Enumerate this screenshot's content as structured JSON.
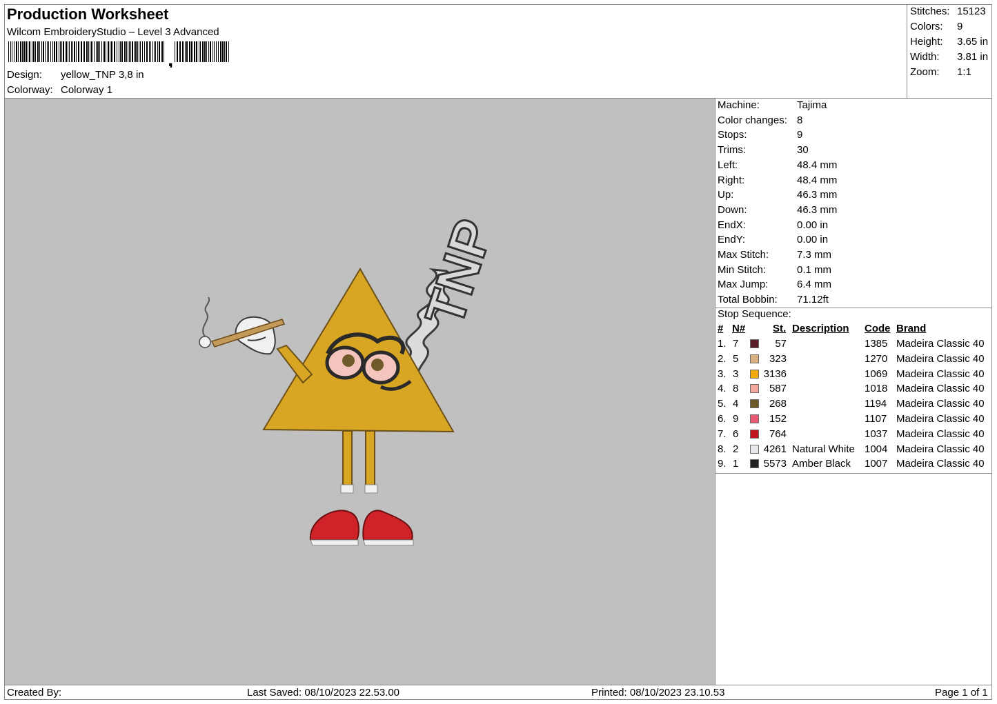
{
  "header": {
    "title": "Production Worksheet",
    "subtitle": "Wilcom EmbroideryStudio – Level 3 Advanced",
    "design_label": "Design:",
    "design_value": "yellow_TNP 3,8 in",
    "colorway_label": "Colorway:",
    "colorway_value": "Colorway 1"
  },
  "summary": [
    {
      "k": "Stitches:",
      "v": "15123"
    },
    {
      "k": "Colors:",
      "v": "9"
    },
    {
      "k": "Height:",
      "v": "3.65 in"
    },
    {
      "k": "Width:",
      "v": "3.81 in"
    },
    {
      "k": "Zoom:",
      "v": "1:1"
    }
  ],
  "machine_info": [
    {
      "k": "Machine:",
      "v": "Tajima"
    },
    {
      "k": "Color changes:",
      "v": "8"
    },
    {
      "k": "Stops:",
      "v": "9"
    },
    {
      "k": "Trims:",
      "v": "30"
    },
    {
      "k": "Left:",
      "v": "48.4 mm"
    },
    {
      "k": "Right:",
      "v": "48.4 mm"
    },
    {
      "k": "Up:",
      "v": "46.3 mm"
    },
    {
      "k": "Down:",
      "v": "46.3 mm"
    },
    {
      "k": "EndX:",
      "v": "0.00 in"
    },
    {
      "k": "EndY:",
      "v": "0.00 in"
    },
    {
      "k": "Max Stitch:",
      "v": "7.3 mm"
    },
    {
      "k": "Min Stitch:",
      "v": "0.1 mm"
    },
    {
      "k": "Max Jump:",
      "v": "6.4 mm"
    },
    {
      "k": "Total Bobbin:",
      "v": "71.12ft"
    }
  ],
  "stop_sequence": {
    "title": "Stop Sequence:",
    "headers": {
      "num": "#",
      "n": "N#",
      "st": "St.",
      "desc": "Description",
      "code": "Code",
      "brand": "Brand"
    },
    "rows": [
      {
        "num": "1.",
        "n": "7",
        "color": "#5c1f2a",
        "st": "57",
        "desc": "",
        "code": "1385",
        "brand": "Madeira Classic 40"
      },
      {
        "num": "2.",
        "n": "5",
        "color": "#d9b07f",
        "st": "323",
        "desc": "",
        "code": "1270",
        "brand": "Madeira Classic 40"
      },
      {
        "num": "3.",
        "n": "3",
        "color": "#f1a80f",
        "st": "3136",
        "desc": "",
        "code": "1069",
        "brand": "Madeira Classic 40"
      },
      {
        "num": "4.",
        "n": "8",
        "color": "#f2a89a",
        "st": "587",
        "desc": "",
        "code": "1018",
        "brand": "Madeira Classic 40"
      },
      {
        "num": "5.",
        "n": "4",
        "color": "#6f5a2a",
        "st": "268",
        "desc": "",
        "code": "1194",
        "brand": "Madeira Classic 40"
      },
      {
        "num": "6.",
        "n": "9",
        "color": "#e85a74",
        "st": "152",
        "desc": "",
        "code": "1107",
        "brand": "Madeira Classic 40"
      },
      {
        "num": "7.",
        "n": "6",
        "color": "#c0141f",
        "st": "764",
        "desc": "",
        "code": "1037",
        "brand": "Madeira Classic 40"
      },
      {
        "num": "8.",
        "n": "2",
        "color": "#e7e7ec",
        "st": "4261",
        "desc": "Natural White",
        "code": "1004",
        "brand": "Madeira Classic 40"
      },
      {
        "num": "9.",
        "n": "1",
        "color": "#222222",
        "st": "5573",
        "desc": "Amber Black",
        "code": "1007",
        "brand": "Madeira Classic 40"
      }
    ]
  },
  "footer": {
    "created_by": "Created By:",
    "last_saved": "Last Saved: 08/10/2023 22.53.00",
    "printed": "Printed: 08/10/2023 23.10.53",
    "page": "Page 1 of 1"
  },
  "design_graphic": {
    "lettering": "TNP"
  }
}
